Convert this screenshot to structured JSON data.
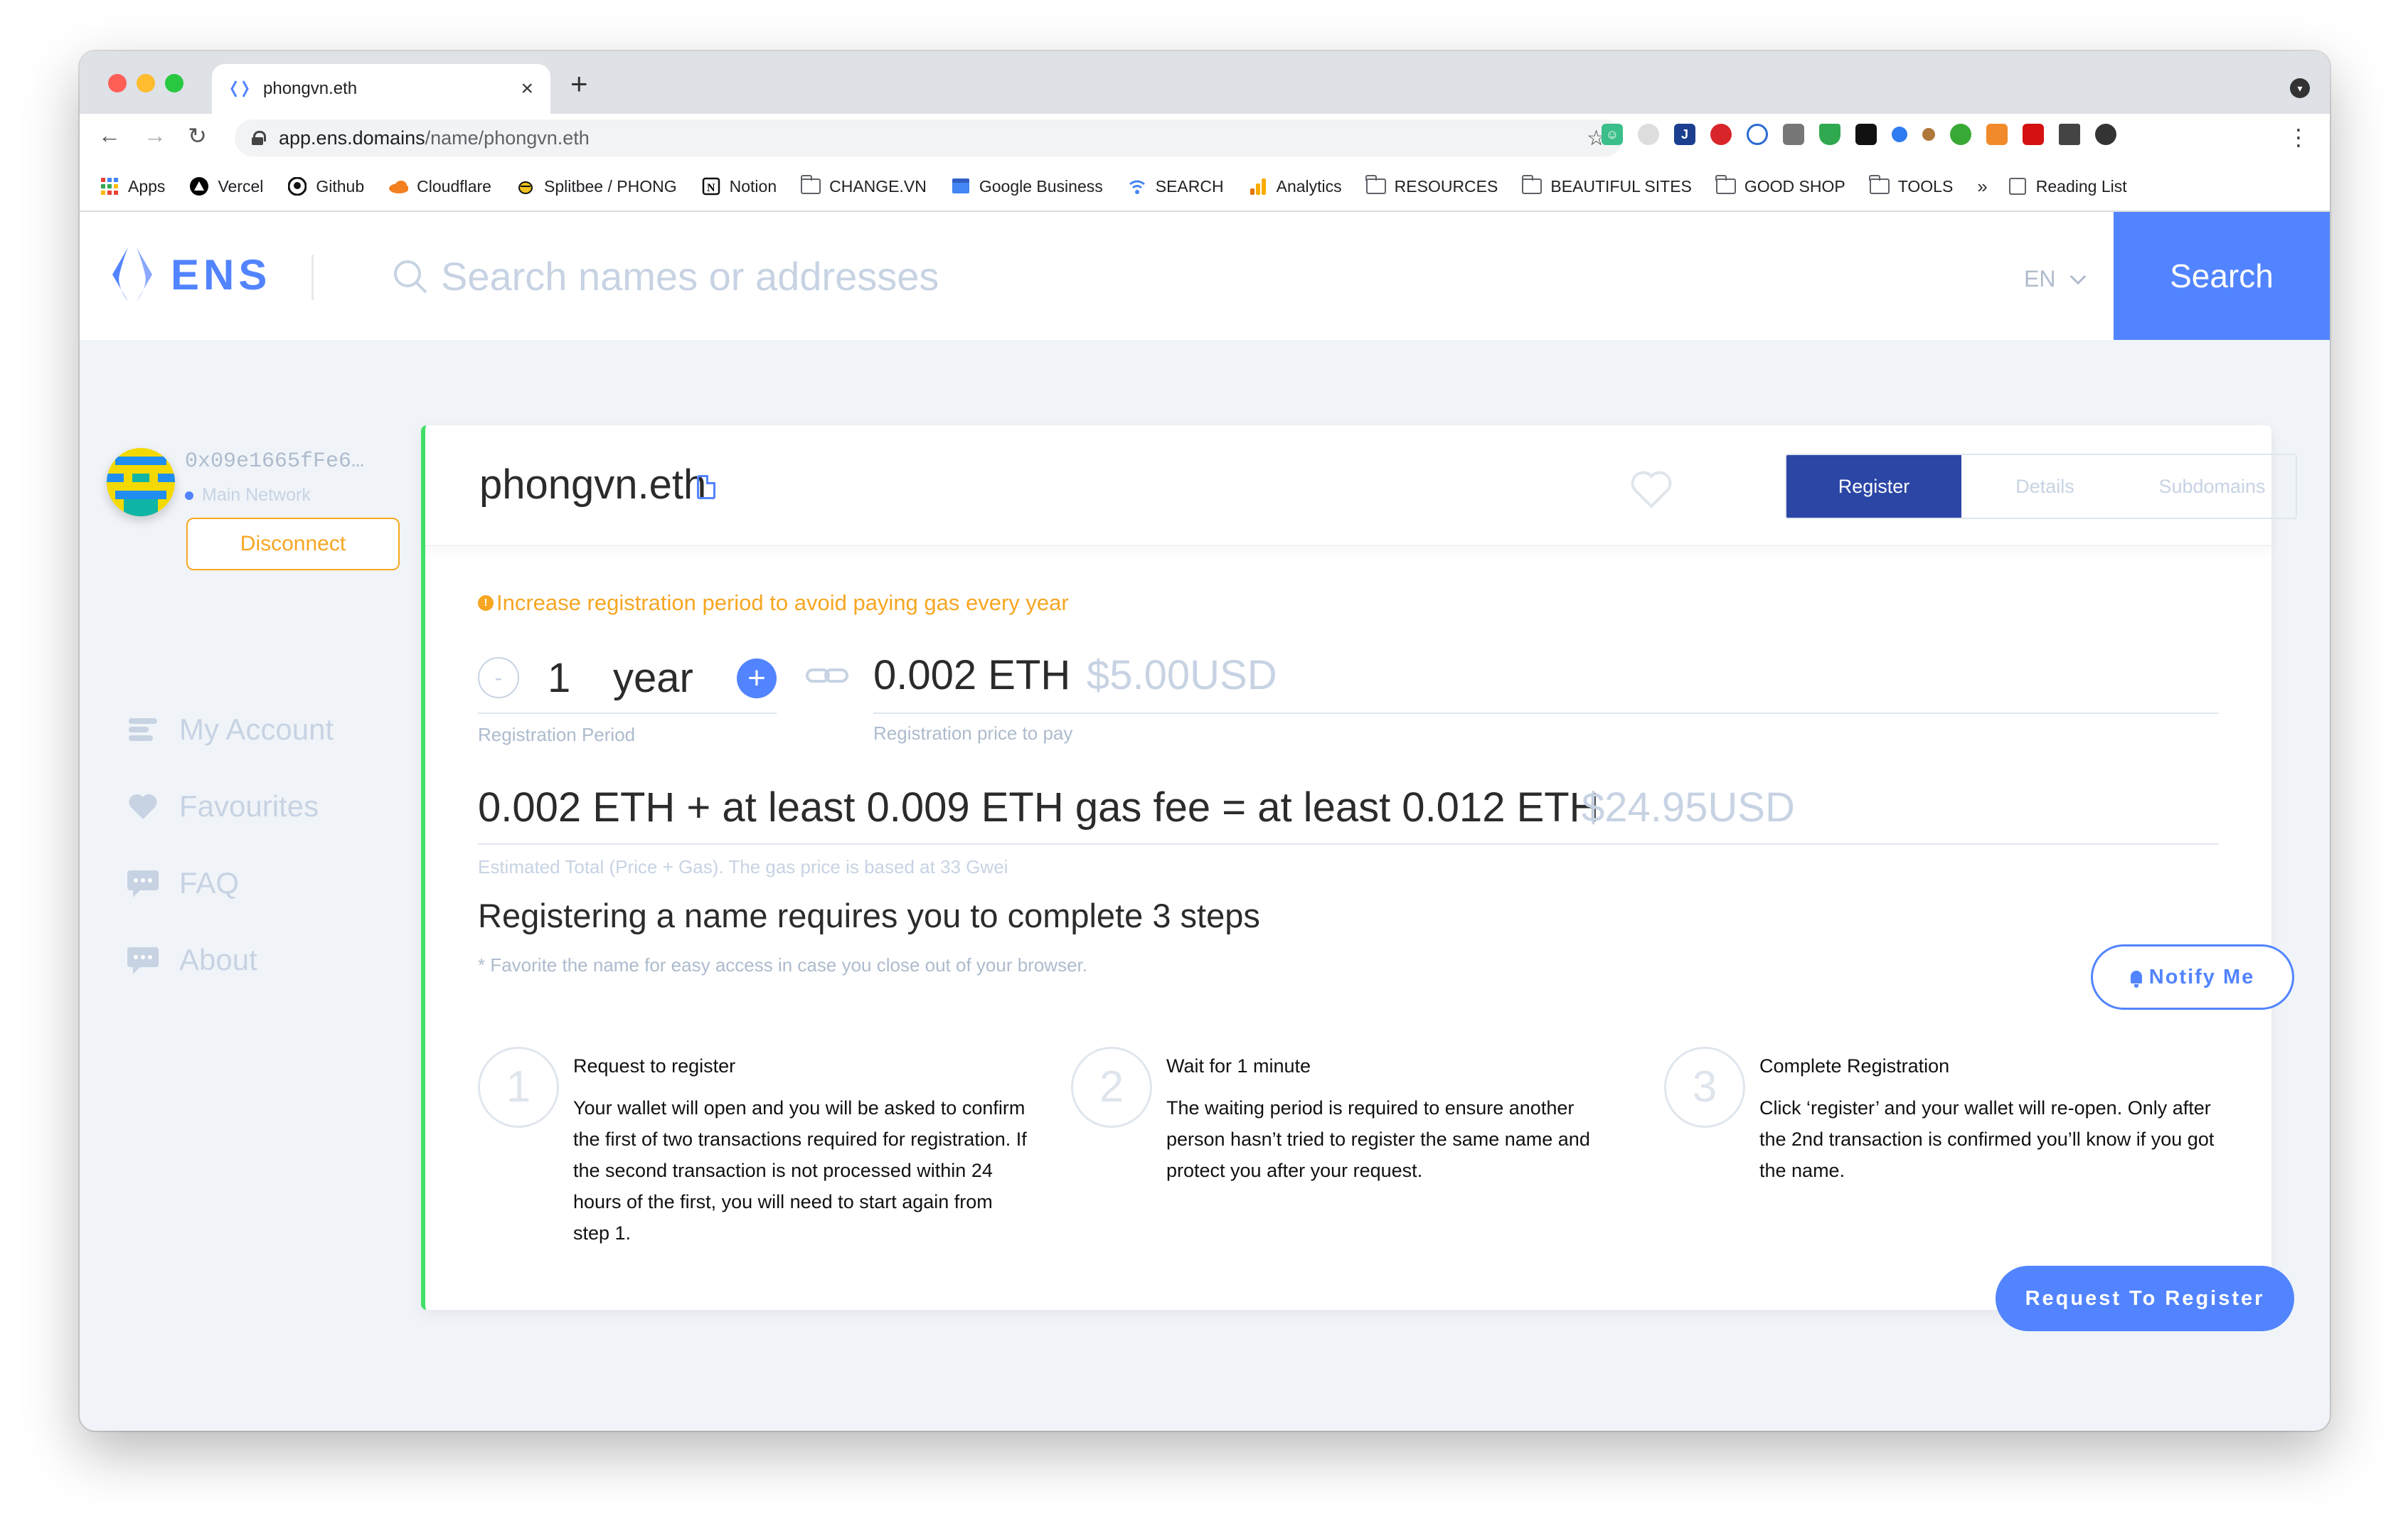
{
  "browser": {
    "tab_title": "phongvn.eth",
    "tab_close": "×",
    "new_tab": "+",
    "url_host": "app.ens.domains",
    "url_path": "/name/phongvn.eth",
    "nav_back": "←",
    "nav_forward": "→",
    "nav_reload": "↻",
    "star": "☆",
    "menu": "⋮",
    "bookmarks": [
      {
        "label": "Apps",
        "icon": "apps-grid-icon"
      },
      {
        "label": "Vercel",
        "icon": "vercel-icon"
      },
      {
        "label": "Github",
        "icon": "github-icon"
      },
      {
        "label": "Cloudflare",
        "icon": "cloudflare-icon"
      },
      {
        "label": "Splitbee / PHONG",
        "icon": "splitbee-icon"
      },
      {
        "label": "Notion",
        "icon": "notion-icon"
      },
      {
        "label": "CHANGE.VN",
        "icon": "folder-icon"
      },
      {
        "label": "Google Business",
        "icon": "google-business-icon"
      },
      {
        "label": "SEARCH",
        "icon": "search-site-icon"
      },
      {
        "label": "Analytics",
        "icon": "analytics-icon"
      },
      {
        "label": "RESOURCES",
        "icon": "folder-icon"
      },
      {
        "label": "BEAUTIFUL SITES",
        "icon": "folder-icon"
      },
      {
        "label": "GOOD SHOP",
        "icon": "folder-icon"
      },
      {
        "label": "TOOLS",
        "icon": "folder-icon"
      }
    ],
    "more_bookmarks": "»",
    "reading_list": "Reading List"
  },
  "header": {
    "logo_text": "ENS",
    "search_placeholder": "Search names or addresses",
    "language": "EN",
    "search_button": "Search"
  },
  "account": {
    "address": "0x09e1665fFe6…",
    "network": "Main Network",
    "disconnect": "Disconnect"
  },
  "nav": {
    "items": [
      {
        "label": "My Account",
        "icon": "account-icon"
      },
      {
        "label": "Favourites",
        "icon": "heart-icon"
      },
      {
        "label": "FAQ",
        "icon": "chat-icon"
      },
      {
        "label": "About",
        "icon": "chat-icon"
      }
    ]
  },
  "domain": {
    "name": "phongvn.eth",
    "tabs": [
      "Register",
      "Details",
      "Subdomains"
    ],
    "active_tab": "Register"
  },
  "registration": {
    "warning_icon": "!",
    "warning": "Increase registration period to avoid paying gas every year",
    "minus": "-",
    "plus": "+",
    "years": "1",
    "unit": "year",
    "period_label": "Registration Period",
    "price_eth": "0.002 ETH",
    "price_usd": "$5.00USD",
    "price_label": "Registration price to pay",
    "total_eth": "0.002 ETH + at least 0.009 ETH gas fee = at least 0.012 ETH",
    "total_usd": "$24.95USD",
    "total_label": "Estimated Total (Price + Gas). The gas price is based at 33 Gwei"
  },
  "steps": {
    "title": "Registering a name requires you to complete 3 steps",
    "subtitle": "* Favorite the name for easy access in case you close out of your browser.",
    "notify": "Notify Me",
    "items": [
      {
        "num": "1",
        "title": "Request to register",
        "text": "Your wallet will open and you will be asked to confirm the first of two transactions required for registration. If the second transaction is not processed within 24 hours of the first, you will need to start again from step 1."
      },
      {
        "num": "2",
        "title": "Wait for 1 minute",
        "text": "The waiting period is required to ensure another person hasn’t tried to register the same name and protect you after your request."
      },
      {
        "num": "3",
        "title": "Complete Registration",
        "text": "Click ‘register’ and your wallet will re-open. Only after the 2nd transaction is confirmed you’ll know if you got the name."
      }
    ],
    "request_button": "Request To Register"
  },
  "colors": {
    "brand": "#5284ff",
    "active_tab": "#2c46a6",
    "warning": "#f6a623",
    "accent_border": "#42e068"
  }
}
